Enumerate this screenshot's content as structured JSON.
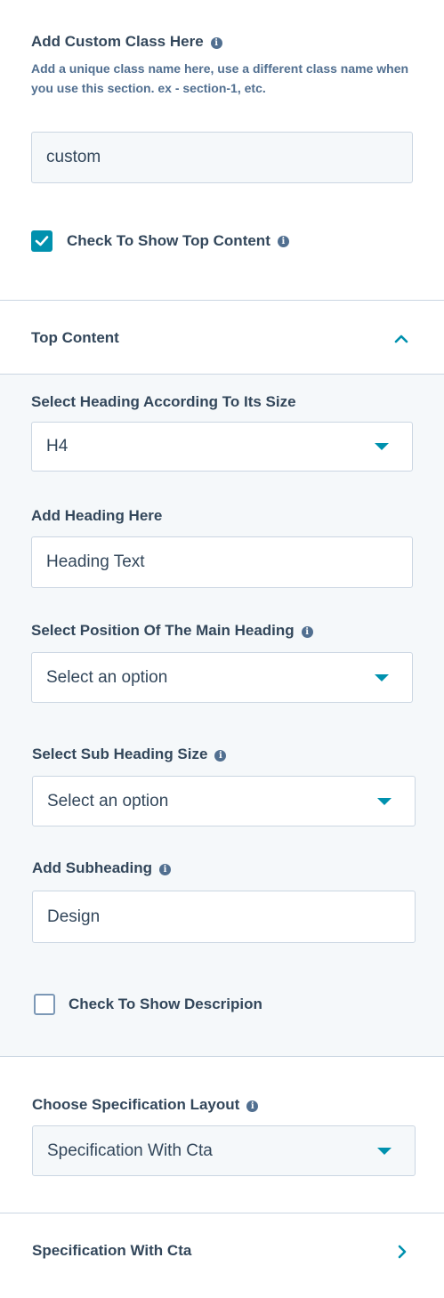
{
  "custom_class": {
    "label": "Add Custom Class Here",
    "help": "Add a unique class name here, use a different class name when you use this section. ex - section-1, etc.",
    "value": "custom"
  },
  "show_top_content": {
    "label": "Check To Show Top Content",
    "checked": true
  },
  "top_content_section": {
    "title": "Top Content",
    "expanded": true
  },
  "heading_size": {
    "label": "Select Heading According To Its Size",
    "value": "H4"
  },
  "heading_text": {
    "label": "Add Heading Here",
    "value": "Heading Text"
  },
  "heading_position": {
    "label": "Select Position Of The Main Heading",
    "value": "Select an option"
  },
  "sub_heading_size": {
    "label": "Select Sub Heading Size",
    "value": "Select an option"
  },
  "subheading": {
    "label": "Add Subheading",
    "value": "Design"
  },
  "show_description": {
    "label": "Check To Show Descripion",
    "checked": false
  },
  "spec_layout": {
    "label": "Choose Specification Layout",
    "value": "Specification With Cta"
  },
  "spec_section": {
    "title": "Specification With Cta",
    "expanded": false
  },
  "colors": {
    "accent": "#0091ae",
    "text": "#33475b",
    "border": "#cbd6e2",
    "panel": "#f5f8fa"
  }
}
